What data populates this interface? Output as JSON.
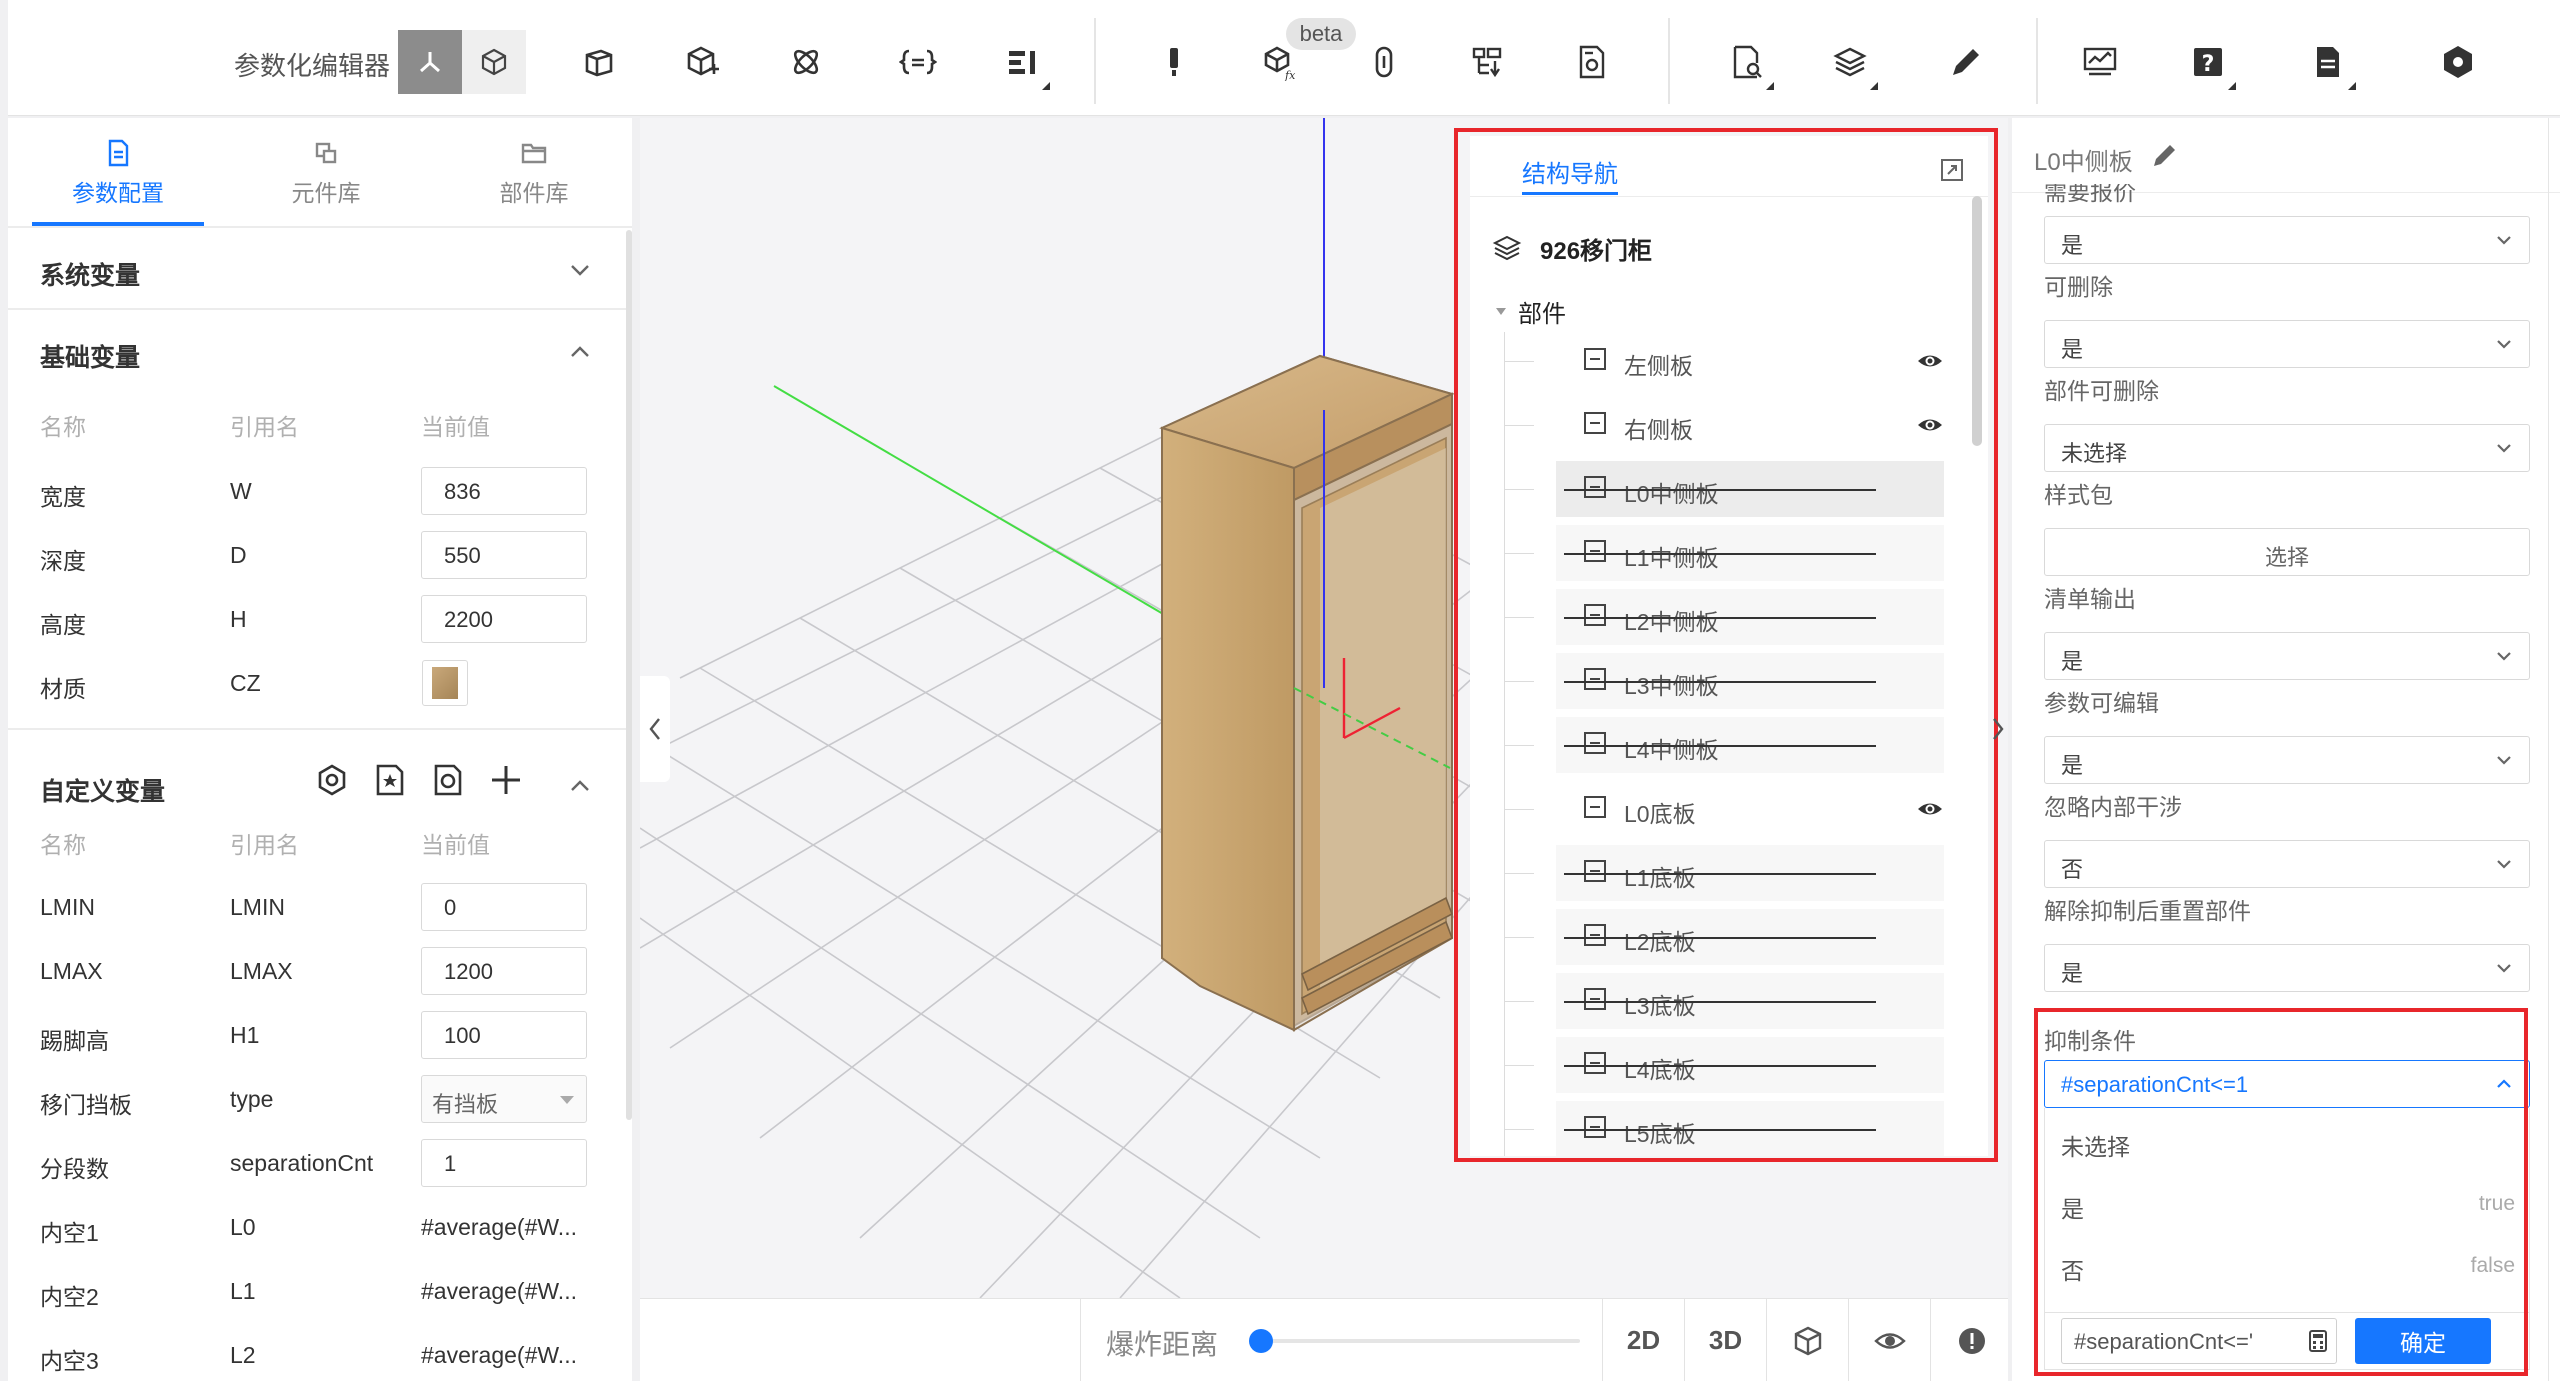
{
  "toolbar": {
    "title": "参数化编辑器",
    "beta_label": "beta",
    "mode_buttons": [
      "axis-mode-icon",
      "cube-mode-icon"
    ],
    "icons": [
      "box-frame-icon",
      "box-plus-icon",
      "atom-icon",
      "bracket-code-icon",
      "layout-bars-icon",
      "pin-icon",
      "box-fx-icon",
      "link-icon",
      "grid-tree-icon",
      "doc-gear-icon",
      "doc-edit-icon",
      "layers-icon",
      "pencil-icon",
      "monitor-chart-icon",
      "help-icon",
      "document-icon",
      "hexagon-icon"
    ]
  },
  "left": {
    "tabs": [
      {
        "label": "参数配置",
        "icon": "document-icon",
        "active": true
      },
      {
        "label": "元件库",
        "icon": "component-icon",
        "active": false
      },
      {
        "label": "部件库",
        "icon": "folder-icon",
        "active": false
      }
    ],
    "system_vars": {
      "title": "系统变量",
      "expanded": false
    },
    "basic_vars": {
      "title": "基础变量",
      "columns": [
        "名称",
        "引用名",
        "当前值"
      ],
      "rows": [
        {
          "name": "宽度",
          "ref": "W",
          "value": "836"
        },
        {
          "name": "深度",
          "ref": "D",
          "value": "550"
        },
        {
          "name": "高度",
          "ref": "H",
          "value": "2200"
        },
        {
          "name": "材质",
          "ref": "CZ",
          "value": ""
        }
      ]
    },
    "custom_vars": {
      "title": "自定义变量",
      "columns": [
        "名称",
        "引用名",
        "当前值"
      ],
      "icons": [
        "target-icon",
        "star-doc-icon",
        "refresh-doc-icon",
        "plus-icon"
      ],
      "rows": [
        {
          "name": "LMIN",
          "ref": "LMIN",
          "value": "0",
          "kind": "input"
        },
        {
          "name": "LMAX",
          "ref": "LMAX",
          "value": "1200",
          "kind": "input"
        },
        {
          "name": "踢脚高",
          "ref": "H1",
          "value": "100",
          "kind": "input"
        },
        {
          "name": "移门挡板",
          "ref": "type",
          "value": "有挡板",
          "kind": "select"
        },
        {
          "name": "分段数",
          "ref": "separationCnt",
          "value": "1",
          "kind": "input"
        },
        {
          "name": "内空1",
          "ref": "L0",
          "value": "#average(#W...",
          "kind": "text"
        },
        {
          "name": "内空2",
          "ref": "L1",
          "value": "#average(#W...",
          "kind": "text"
        },
        {
          "name": "内空3",
          "ref": "L2",
          "value": "#average(#W...",
          "kind": "text"
        }
      ]
    }
  },
  "viewport": {
    "explode_label": "爆炸距离",
    "explode_value": 0,
    "view_buttons": [
      "2D",
      "3D"
    ],
    "icon_buttons": [
      "cube-view-icon",
      "eye-icon",
      "alert-icon"
    ]
  },
  "nav": {
    "tab": "结构导航",
    "root": "926移门柜",
    "group": "部件",
    "items": [
      {
        "label": "左侧板",
        "suppressed": false,
        "selected": false
      },
      {
        "label": "右侧板",
        "suppressed": false,
        "selected": false
      },
      {
        "label": "L0中侧板",
        "suppressed": true,
        "selected": true
      },
      {
        "label": "L1中侧板",
        "suppressed": true,
        "selected": false
      },
      {
        "label": "L2中侧板",
        "suppressed": true,
        "selected": false
      },
      {
        "label": "L3中侧板",
        "suppressed": true,
        "selected": false
      },
      {
        "label": "L4中侧板",
        "suppressed": true,
        "selected": false
      },
      {
        "label": "L0底板",
        "suppressed": false,
        "selected": false
      },
      {
        "label": "L1底板",
        "suppressed": true,
        "selected": false
      },
      {
        "label": "L2底板",
        "suppressed": true,
        "selected": false
      },
      {
        "label": "L3底板",
        "suppressed": true,
        "selected": false
      },
      {
        "label": "L4底板",
        "suppressed": true,
        "selected": false
      },
      {
        "label": "L5底板",
        "suppressed": true,
        "selected": false
      }
    ]
  },
  "right": {
    "title": "L0中侧板",
    "fields": [
      {
        "label": "需要报价",
        "value": "是"
      },
      {
        "label": "可删除",
        "value": "是"
      },
      {
        "label": "部件可删除",
        "value": "未选择"
      },
      {
        "label": "样式包",
        "value": "选择"
      },
      {
        "label": "清单输出",
        "value": "是"
      },
      {
        "label": "参数可编辑",
        "value": "是"
      },
      {
        "label": "忽略内部干涉",
        "value": "否"
      },
      {
        "label": "解除抑制后重置部件",
        "value": "是"
      }
    ],
    "suppress": {
      "label": "抑制条件",
      "value": "#separationCnt<=1",
      "options": [
        {
          "label": "未选择",
          "value": ""
        },
        {
          "label": "是",
          "value": "true"
        },
        {
          "label": "否",
          "value": "false"
        }
      ],
      "input_value": "#separationCnt<='",
      "confirm_label": "确定"
    }
  }
}
